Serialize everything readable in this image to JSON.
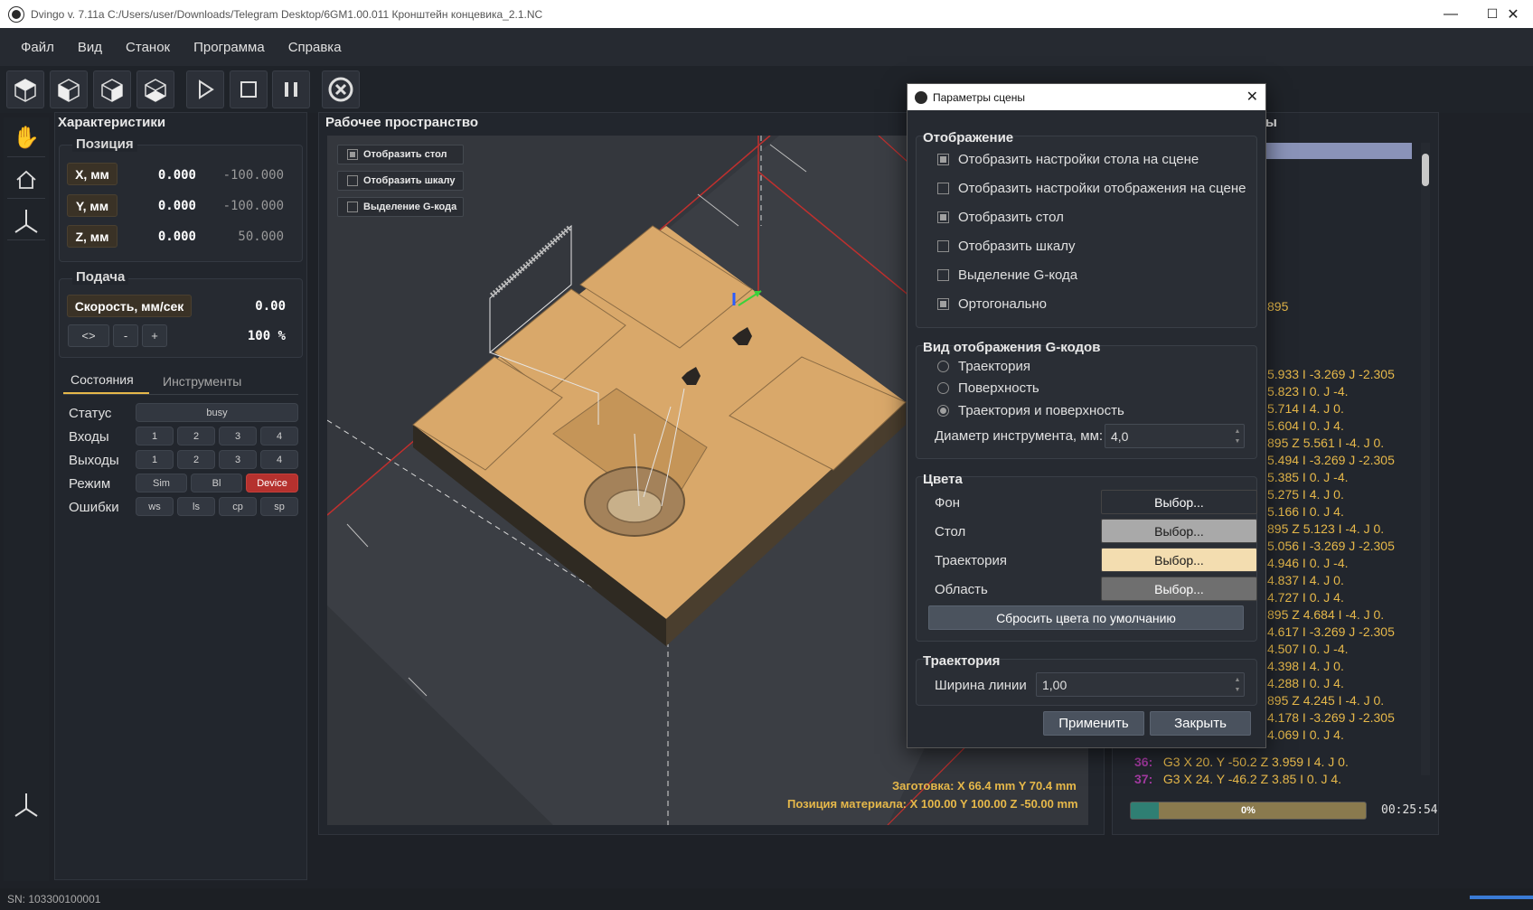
{
  "window": {
    "title": "Dvingo v. 7.11a C:/Users/user/Downloads/Telegram Desktop/6GM1.00.011 Кронштейн концевика_2.1.NC",
    "minimize": "—",
    "maximize": "☐",
    "close": "✕"
  },
  "menu": [
    "Файл",
    "Вид",
    "Станок",
    "Программа",
    "Справка"
  ],
  "toolbar_icons": [
    "view-iso-icon",
    "view-front-icon",
    "view-side-icon",
    "view-top-icon",
    "play-icon",
    "stop-icon",
    "pause-icon",
    "cancel-icon"
  ],
  "characteristics": {
    "title": "Характеристики",
    "position": {
      "title": "Позиция",
      "rows": [
        {
          "label": "X, мм",
          "value": "0.000",
          "machine": "-100.000"
        },
        {
          "label": "Y, мм",
          "value": "0.000",
          "machine": "-100.000"
        },
        {
          "label": "Z, мм",
          "value": "0.000",
          "machine": "50.000"
        }
      ]
    },
    "feed": {
      "title": "Подача",
      "speed_label": "Скорость, мм/сек",
      "speed_value": "0.00",
      "buttons": [
        "<>",
        "-",
        "+"
      ],
      "percent": "100 %"
    },
    "tabs": [
      "Состояния",
      "Инструменты"
    ],
    "states": {
      "status_label": "Статус",
      "status_value": "busy",
      "inputs_label": "Входы",
      "inputs": [
        "1",
        "2",
        "3",
        "4"
      ],
      "outputs_label": "Выходы",
      "outputs": [
        "1",
        "2",
        "3",
        "4"
      ],
      "mode_label": "Режим",
      "modes": [
        "Sim",
        "Bl",
        "Device"
      ],
      "errors_label": "Ошибки",
      "errors": [
        "ws",
        "ls",
        "cp",
        "sp"
      ]
    }
  },
  "workspace": {
    "title": "Рабочее пространство",
    "checks": [
      {
        "label": "Отобразить стол",
        "checked": true
      },
      {
        "label": "Отобразить шкалу",
        "checked": false
      },
      {
        "label": "Выделение G-кода",
        "checked": false
      }
    ],
    "blank_info": "Заготовка: X 66.4 mm   Y 70.4 mm",
    "material_pos": "Позиция материала: X 100.00   Y 100.00   Z -50.00 mm",
    "colors": {
      "background": "#34373d",
      "part": "#d9a86a",
      "table_line": "#c0302e"
    }
  },
  "gcode": {
    "title_fragment": "ы",
    "lines_partial": [
      "895",
      "5.933 I -3.269 J -2.305",
      "5.823 I 0. J -4.",
      "5.714 I 4. J 0.",
      "5.604 I 0. J 4.",
      "895 Z 5.561 I -4. J 0.",
      "5.494 I -3.269 J -2.305",
      "5.385 I 0. J -4.",
      "5.275 I 4. J 0.",
      "5.166 I 0. J 4.",
      "895 Z 5.123 I -4. J 0.",
      "5.056 I -3.269 J -2.305",
      "4.946 I 0. J -4.",
      "4.837 I 4. J 0.",
      "4.727 I 0. J 4.",
      "895 Z 4.684 I -4. J 0.",
      "4.617 I -3.269 J -2.305",
      "4.507 I 0. J -4.",
      "4.398 I 4. J 0.",
      "4.288 I 0. J 4.",
      "895 Z 4.245 I -4. J 0.",
      "4.178 I -3.269 J -2.305",
      "4.069 I 0. J 4."
    ],
    "line36_num": "36:",
    "line36": "G3 X 20. Y -50.2 Z 3.959 I 4. J 0.",
    "line37_num": "37:",
    "line37": "G3 X 24. Y -46.2 Z 3.85 I 0. J 4.",
    "progress_label": "0%",
    "progress": 0.12,
    "time": "00:25:54"
  },
  "dialog": {
    "title": "Параметры сцены",
    "display": {
      "title": "Отображение",
      "items": [
        {
          "label": "Отобразить настройки стола на сцене",
          "checked": true
        },
        {
          "label": "Отобразить настройки отображения на сцене",
          "checked": false
        },
        {
          "label": "Отобразить стол",
          "checked": true
        },
        {
          "label": "Отобразить шкалу",
          "checked": false
        },
        {
          "label": "Выделение G-кода",
          "checked": false
        },
        {
          "label": "Ортогонально",
          "checked": true
        }
      ]
    },
    "gcode_view": {
      "title": "Вид отображения G-кодов",
      "options": [
        {
          "label": "Траектория",
          "selected": false
        },
        {
          "label": "Поверхность",
          "selected": false
        },
        {
          "label": "Траектория и поверхность",
          "selected": true
        }
      ],
      "tool_diameter_label": "Диаметр инструмента, мм:",
      "tool_diameter": "4,0"
    },
    "colors": {
      "title": "Цвета",
      "rows": [
        {
          "label": "Фон",
          "button": "Выбор...",
          "color": "#2a2e35",
          "text": "#ffffff"
        },
        {
          "label": "Стол",
          "button": "Выбор...",
          "color": "#a9a9a9",
          "text": "#1a1a1a"
        },
        {
          "label": "Траектория",
          "button": "Выбор...",
          "color": "#f3ddb0",
          "text": "#1a1a1a"
        },
        {
          "label": "Область",
          "button": "Выбор...",
          "color": "#6f6f6f",
          "text": "#ffffff"
        }
      ],
      "reset": "Сбросить цвета по умолчанию"
    },
    "trajectory": {
      "title": "Траектория",
      "line_width_label": "Ширина линии",
      "line_width": "1,00"
    },
    "apply": "Применить",
    "close": "Закрыть"
  },
  "status": {
    "serial": "SN: 103300100001"
  }
}
